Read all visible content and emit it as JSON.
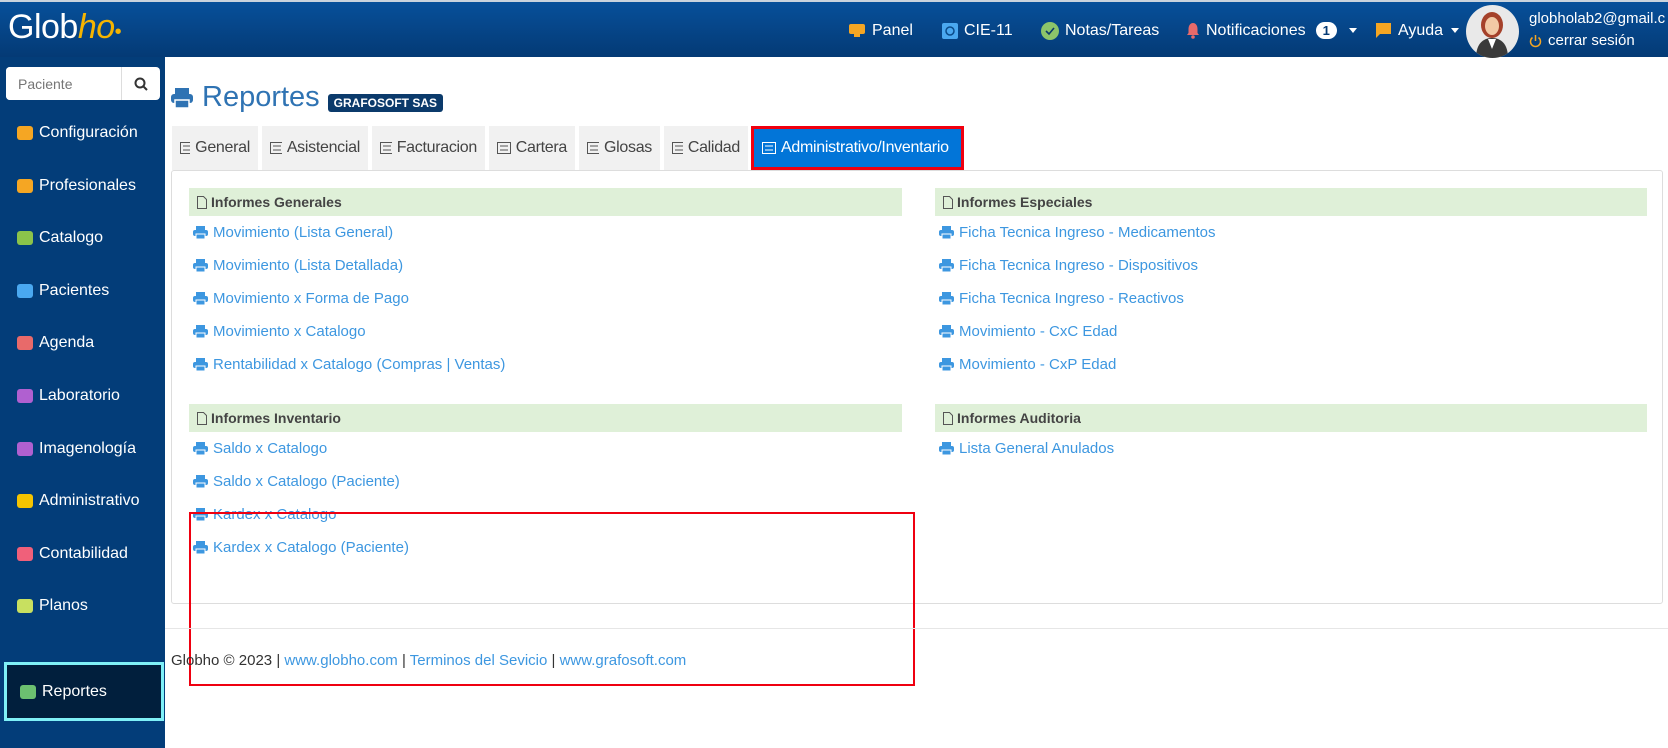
{
  "header": {
    "logo": {
      "main": "Glob",
      "accent": "ho"
    },
    "nav": [
      {
        "label": "Panel",
        "icon": "monitor-icon"
      },
      {
        "label": "CIE-11",
        "icon": "cie-icon"
      },
      {
        "label": "Notas/Tareas",
        "icon": "check-circle-icon"
      },
      {
        "label": "Notificaciones",
        "icon": "bell-icon",
        "badge": "1"
      },
      {
        "label": "Ayuda",
        "icon": "chat-icon"
      }
    ],
    "user": {
      "email": "globholab2@gmail.c",
      "logout": "cerrar sesión"
    }
  },
  "sidebar": {
    "search_placeholder": "Paciente",
    "items": [
      {
        "label": "Configuración",
        "icon": "gear-icon",
        "color": "#f5a623"
      },
      {
        "label": "Profesionales",
        "icon": "users-icon",
        "color": "#f5a623"
      },
      {
        "label": "Catalogo",
        "icon": "tag-icon",
        "color": "#8bc34a"
      },
      {
        "label": "Pacientes",
        "icon": "user-circle-icon",
        "color": "#4aa8f0"
      },
      {
        "label": "Agenda",
        "icon": "calendar-icon",
        "color": "#e86a6a"
      },
      {
        "label": "Laboratorio",
        "icon": "drop-icon",
        "color": "#b060d0"
      },
      {
        "label": "Imagenología",
        "icon": "image-icon",
        "color": "#b060d0"
      },
      {
        "label": "Administrativo",
        "icon": "grid-icon",
        "color": "#f5c400"
      },
      {
        "label": "Contabilidad",
        "icon": "bookmark-icon",
        "color": "#f0607a"
      },
      {
        "label": "Planos",
        "icon": "file-zip-icon",
        "color": "#c8e060"
      },
      {
        "label": "Reportes",
        "icon": "printer-icon",
        "color": "#6cc070"
      }
    ]
  },
  "page": {
    "title": "Reportes",
    "org": "GRAFOSOFT SAS",
    "tabs": [
      "General",
      "Asistencial",
      "Facturacion",
      "Cartera",
      "Glosas",
      "Calidad",
      "Administrativo/Inventario"
    ],
    "sections": [
      {
        "title": "Informes Generales",
        "links": [
          "Movimiento (Lista General)",
          "Movimiento (Lista Detallada)",
          "Movimiento x Forma de Pago",
          "Movimiento x Catalogo",
          "Rentabilidad x Catalogo (Compras | Ventas)"
        ]
      },
      {
        "title": "Informes Especiales",
        "links": [
          "Ficha Tecnica Ingreso - Medicamentos",
          "Ficha Tecnica Ingreso - Dispositivos",
          "Ficha Tecnica Ingreso - Reactivos",
          "Movimiento - CxC Edad",
          "Movimiento - CxP Edad"
        ]
      },
      {
        "title": "Informes Inventario",
        "links": [
          "Saldo x Catalogo",
          "Saldo x Catalogo (Paciente)",
          "Kardex x Catalogo",
          "Kardex x Catalogo (Paciente)"
        ]
      },
      {
        "title": "Informes Auditoria",
        "links": [
          "Lista General Anulados"
        ]
      }
    ]
  },
  "footer": {
    "copyright": "Globho © 2023",
    "sep": "|",
    "links": [
      "www.globho.com",
      "Terminos del Sevicio",
      "www.grafosoft.com"
    ]
  }
}
